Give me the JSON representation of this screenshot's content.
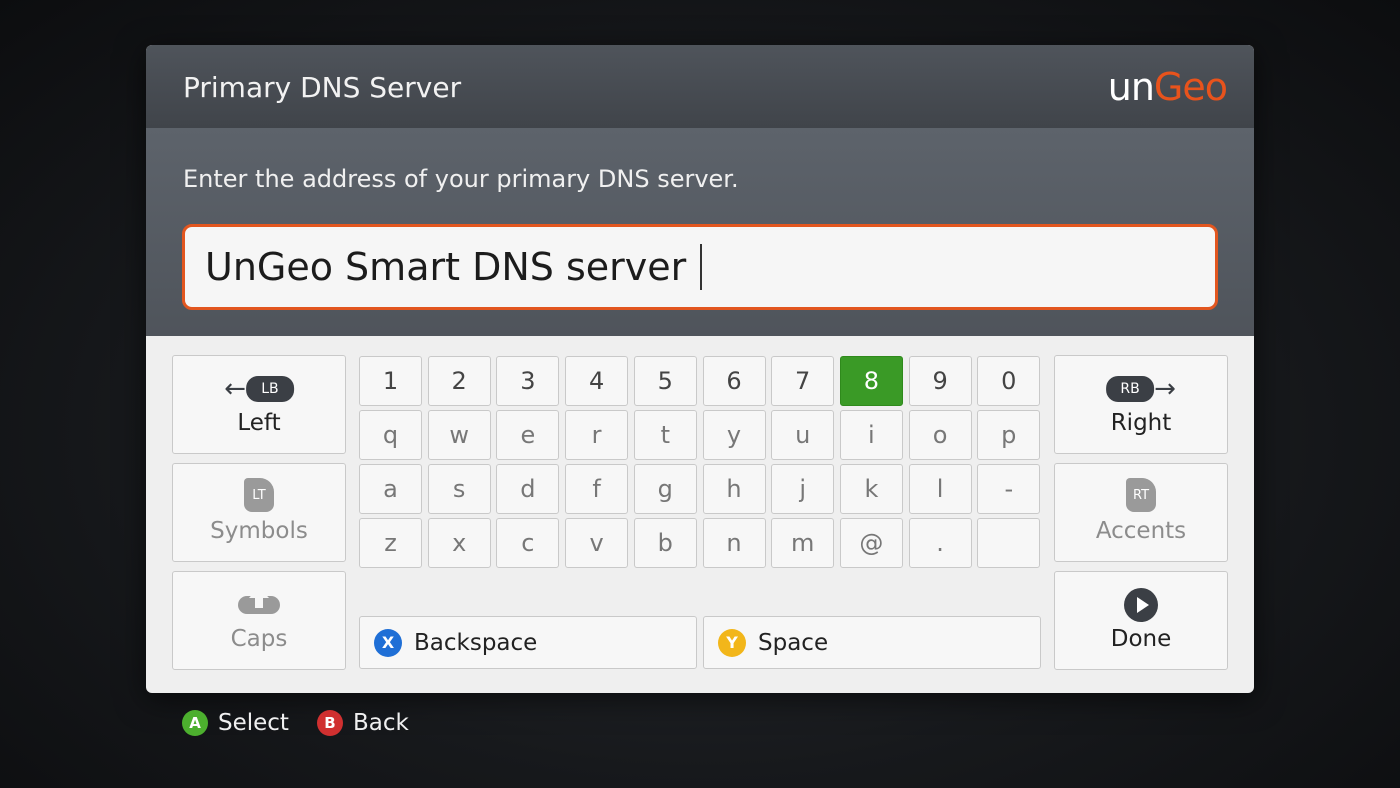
{
  "dialog": {
    "title": "Primary DNS Server",
    "logo_part1": "un",
    "logo_part2": "Geo",
    "prompt": "Enter the address of your primary DNS server.",
    "input_value": "UnGeo Smart DNS server"
  },
  "keyboard": {
    "rows": [
      [
        "1",
        "2",
        "3",
        "4",
        "5",
        "6",
        "7",
        "8",
        "9",
        "0"
      ],
      [
        "q",
        "w",
        "e",
        "r",
        "t",
        "y",
        "u",
        "i",
        "o",
        "p"
      ],
      [
        "a",
        "s",
        "d",
        "f",
        "g",
        "h",
        "j",
        "k",
        "l",
        "-"
      ],
      [
        "z",
        "x",
        "c",
        "v",
        "b",
        "n",
        "m",
        "@",
        ".",
        ""
      ]
    ],
    "selected_key": "8",
    "left": {
      "label": "Left",
      "badge": "LB"
    },
    "symbols": {
      "label": "Symbols",
      "badge": "LT"
    },
    "caps": {
      "label": "Caps"
    },
    "right": {
      "label": "Right",
      "badge": "RB"
    },
    "accents": {
      "label": "Accents",
      "badge": "RT"
    },
    "done": {
      "label": "Done"
    },
    "backspace": {
      "label": "Backspace",
      "button": "X"
    },
    "space": {
      "label": "Space",
      "button": "Y"
    }
  },
  "hints": [
    {
      "button": "A",
      "label": "Select"
    },
    {
      "button": "B",
      "label": "Back"
    }
  ],
  "colors": {
    "accent": "#e2561f",
    "selected_key": "#3a9a26",
    "button_a": "#4caf2e",
    "button_b": "#d03030",
    "button_x": "#1f6fd6",
    "button_y": "#f2b61a"
  }
}
